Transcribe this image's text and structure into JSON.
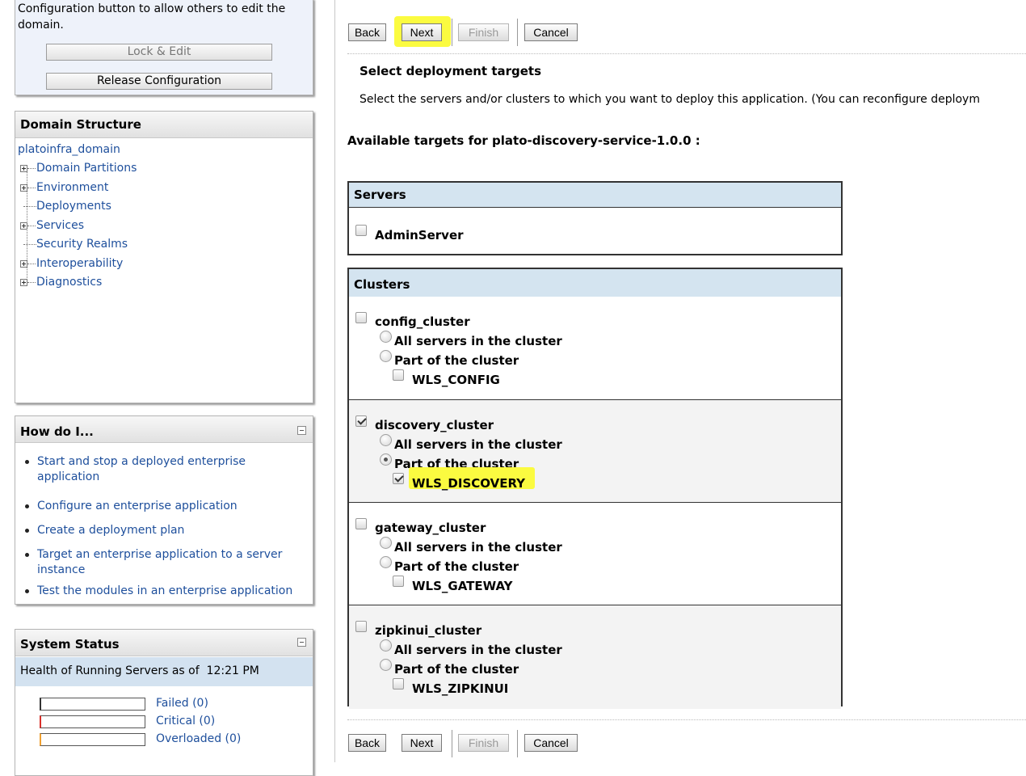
{
  "change_center": {
    "text_line1": "Configuration button to allow others to edit the",
    "text_line2": "domain.",
    "lock_label": "Lock & Edit",
    "release_label": "Release Configuration"
  },
  "domain_structure": {
    "title": "Domain Structure",
    "root": "platoinfra_domain",
    "items": [
      {
        "label": "Domain Partitions",
        "expandable": true
      },
      {
        "label": "Environment",
        "expandable": true
      },
      {
        "label": "Deployments",
        "expandable": false
      },
      {
        "label": "Services",
        "expandable": true
      },
      {
        "label": "Security Realms",
        "expandable": false
      },
      {
        "label": "Interoperability",
        "expandable": true
      },
      {
        "label": "Diagnostics",
        "expandable": true
      }
    ]
  },
  "how_do_i": {
    "title": "How do I...",
    "items": [
      {
        "l1": "Start and stop a deployed enterprise",
        "l2": "application"
      },
      {
        "l1": "Configure an enterprise application",
        "l2": ""
      },
      {
        "l1": "Create a deployment plan",
        "l2": ""
      },
      {
        "l1": "Target an enterprise application to a server",
        "l2": "instance"
      },
      {
        "l1": "Test the modules in an enterprise application",
        "l2": ""
      }
    ]
  },
  "system_status": {
    "title": "System Status",
    "health_label": "Health of Running Servers as of  12:21 PM",
    "rows": [
      {
        "label": "Failed (0)",
        "color": "#333333"
      },
      {
        "label": "Critical (0)",
        "color": "#d9302a"
      },
      {
        "label": "Overloaded (0)",
        "color": "#f0a030"
      }
    ]
  },
  "wizard": {
    "back": "Back",
    "next": "Next",
    "finish": "Finish",
    "cancel": "Cancel",
    "section_title": "Select deployment targets",
    "description": "Select the servers and/or clusters to which you want to deploy this application. (You can reconfigure deploym",
    "available_label": "Available targets for plato-discovery-service-1.0.0 :",
    "servers_header": "Servers",
    "servers": [
      {
        "name": "AdminServer",
        "checked": false
      }
    ],
    "clusters_header": "Clusters",
    "all_servers_label": "All servers in the cluster",
    "part_label": "Part of the cluster",
    "clusters": [
      {
        "name": "config_cluster",
        "checked": false,
        "mode": "none",
        "server": "WLS_CONFIG",
        "server_checked": false
      },
      {
        "name": "discovery_cluster",
        "checked": true,
        "mode": "part",
        "server": "WLS_DISCOVERY",
        "server_checked": true
      },
      {
        "name": "gateway_cluster",
        "checked": false,
        "mode": "none",
        "server": "WLS_GATEWAY",
        "server_checked": false
      },
      {
        "name": "zipkinui_cluster",
        "checked": false,
        "mode": "none",
        "server": "WLS_ZIPKINUI",
        "server_checked": false
      }
    ]
  }
}
